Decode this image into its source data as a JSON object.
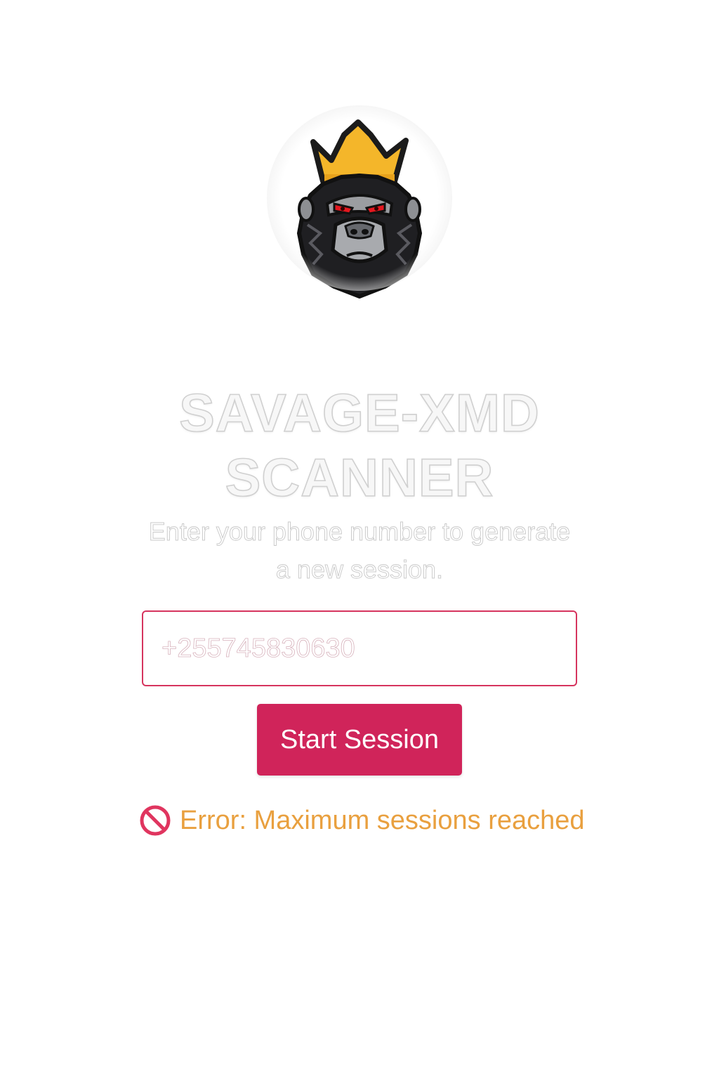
{
  "logo": {
    "icon": "crowned-gorilla-logo",
    "crown_color": "#f4b62a",
    "eye_color": "#e4171f"
  },
  "header": {
    "title_line1": "SAVAGE-XMD",
    "title_line2": "SCANNER"
  },
  "form": {
    "instructions_line1": "Enter your phone number to generate",
    "instructions_line2": "a new session.",
    "phone_placeholder": "+255745830630",
    "submit_label": "Start Session"
  },
  "status": {
    "icon": "prohibited-icon",
    "message": "Error: Maximum sessions reached"
  },
  "colors": {
    "accent": "#d0245a",
    "error_text": "#e9a03f",
    "error_icon": "#e0355f"
  }
}
